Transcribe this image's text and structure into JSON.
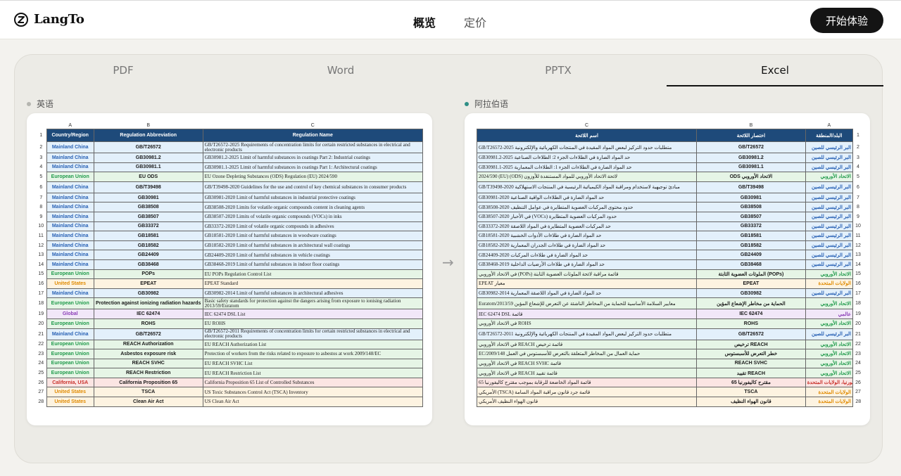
{
  "header": {
    "brand": "LangTo",
    "nav": [
      {
        "label": "概览"
      },
      {
        "label": "定价"
      }
    ],
    "cta": "开始体验"
  },
  "tabs": [
    {
      "label": "PDF"
    },
    {
      "label": "Word"
    },
    {
      "label": "PPTX"
    },
    {
      "label": "Excel"
    }
  ],
  "left_label": "英语",
  "right_label": "阿拉伯语",
  "colors": {
    "accent": "#2f8f86",
    "header_fill": "#1e4a7a",
    "china": "#2962b5",
    "eu": "#1f9a4a",
    "us": "#e08a00",
    "global": "#8c3fb8",
    "california": "#c8302a"
  },
  "left_sheet": {
    "col_letters": [
      "A",
      "B",
      "C"
    ],
    "headers": [
      "Country/Region",
      "Regulation Abbreviation",
      "Regulation Name"
    ],
    "rows": [
      {
        "n": "2",
        "region": "Mainland China",
        "abbr": "GB/T26572",
        "name": "GB/T26572-2025 Requirements of concentration limits for certain restricted substances in electrical and electronic products",
        "t": "china",
        "fill": "#e3f0fb"
      },
      {
        "n": "3",
        "region": "Mainland China",
        "abbr": "GB30981.2",
        "name": "GB30981.2-2025 Limit of harmful substances in coatings Part 2: Industrial coatings",
        "t": "china",
        "fill": "#e3f0fb"
      },
      {
        "n": "4",
        "region": "Mainland China",
        "abbr": "GB30981.1",
        "name": "GB30981.1-2025 Limit of harmful substances in coatings Part 1: Architectural coatings",
        "t": "china",
        "fill": "#e3f0fb"
      },
      {
        "n": "5",
        "region": "European Union",
        "abbr": "EU ODS",
        "name": "EU Ozone Depleting Substances (ODS) Regulation (EU) 2024/590",
        "t": "eu",
        "fill": "#e6f5e6"
      },
      {
        "n": "6",
        "region": "Mainland China",
        "abbr": "GB/T39498",
        "name": "GB/T39498-2020 Guidelines for the use and control of key chemical substances in consumer products",
        "t": "china",
        "fill": "#e3f0fb"
      },
      {
        "n": "7",
        "region": "Mainland China",
        "abbr": "GB30981",
        "name": "GB30981-2020 Limit of harmful substances in industrial protective coatings",
        "t": "china",
        "fill": "#e3f0fb"
      },
      {
        "n": "8",
        "region": "Mainland China",
        "abbr": "GB38508",
        "name": "GB38508-2020 Limits for volatile organic compounds content in cleaning agents",
        "t": "china",
        "fill": "#e3f0fb"
      },
      {
        "n": "9",
        "region": "Mainland China",
        "abbr": "GB38507",
        "name": "GB38507-2020 Limits of volatile organic compounds (VOCs) in inks",
        "t": "china",
        "fill": "#e3f0fb"
      },
      {
        "n": "10",
        "region": "Mainland China",
        "abbr": "GB33372",
        "name": "GB33372-2020 Limit of volatile organic compounds in adhesives",
        "t": "china",
        "fill": "#e3f0fb"
      },
      {
        "n": "11",
        "region": "Mainland China",
        "abbr": "GB18581",
        "name": "GB18581-2020 Limit of harmful substances in woodware coatings",
        "t": "china",
        "fill": "#e3f0fb"
      },
      {
        "n": "12",
        "region": "Mainland China",
        "abbr": "GB18582",
        "name": "GB18582-2020 Limit of harmful substances in architectural wall coatings",
        "t": "china",
        "fill": "#e3f0fb"
      },
      {
        "n": "13",
        "region": "Mainland China",
        "abbr": "GB24409",
        "name": "GB24409-2020 Limit of harmful substances in vehicle coatings",
        "t": "china",
        "fill": "#e3f0fb"
      },
      {
        "n": "14",
        "region": "Mainland China",
        "abbr": "GB38468",
        "name": "GB38468-2019 Limit of harmful substances in indoor floor coatings",
        "t": "china",
        "fill": "#e3f0fb"
      },
      {
        "n": "15",
        "region": "European Union",
        "abbr": "POPs",
        "name": "EU POPs Regulation Control List",
        "t": "eu",
        "fill": "#e6f5e6"
      },
      {
        "n": "16",
        "region": "United States",
        "abbr": "EPEAT",
        "name": "EPEAT Standard",
        "t": "us",
        "fill": "#fdf3e1"
      },
      {
        "n": "17",
        "region": "Mainland China",
        "abbr": "GB30982",
        "name": "GB30982-2014 Limit of harmful substances in architectural adhesives",
        "t": "china",
        "fill": "#e3f0fb"
      },
      {
        "n": "18",
        "region": "European Union",
        "abbr": "Protection against ionizing radiation hazards",
        "name": "Basic safety standards for protection against the dangers arising from exposure to ionising radiation 2013/59/Euratom",
        "t": "eu",
        "fill": "#e6f5e6"
      },
      {
        "n": "19",
        "region": "Global",
        "abbr": "IEC 62474",
        "name": "IEC 62474 DSL List",
        "t": "global",
        "fill": "#f1e7f8"
      },
      {
        "n": "20",
        "region": "European Union",
        "abbr": "ROHS",
        "name": "EU ROHS",
        "t": "eu",
        "fill": "#e6f5e6"
      },
      {
        "n": "21",
        "region": "Mainland China",
        "abbr": "GB/T26572",
        "name": "GB/T26572-2011 Requirements of concentration limits for certain restricted substances in electrical and electronic products",
        "t": "china",
        "fill": "#e3f0fb"
      },
      {
        "n": "22",
        "region": "European Union",
        "abbr": "REACH Authorization",
        "name": "EU REACH Authorization List",
        "t": "eu",
        "fill": "#e6f5e6"
      },
      {
        "n": "23",
        "region": "European Union",
        "abbr": "Asbestos exposure risk",
        "name": "Protection of workers from the risks related to exposure to asbestos at work 2009/148/EC",
        "t": "eu",
        "fill": "#e6f5e6"
      },
      {
        "n": "24",
        "region": "European Union",
        "abbr": "REACH SVHC",
        "name": "EU REACH SVHC List",
        "t": "eu",
        "fill": "#e6f5e6"
      },
      {
        "n": "25",
        "region": "European Union",
        "abbr": "REACH Restriction",
        "name": "EU REACH Restriction List",
        "t": "eu",
        "fill": "#e6f5e6"
      },
      {
        "n": "26",
        "region": "California, USA",
        "abbr": "California Proposition 65",
        "name": "California Proposition 65 List of Controlled Substances",
        "t": "california",
        "fill": "#fbe5e3"
      },
      {
        "n": "27",
        "region": "United States",
        "abbr": "TSCA",
        "name": "US Toxic Substances Control Act (TSCA) Inventory",
        "t": "us",
        "fill": "#fdf3e1"
      },
      {
        "n": "28",
        "region": "United States",
        "abbr": "Clean Air Act",
        "name": "US Clean Air Act",
        "t": "us",
        "fill": "#fdf3e1"
      }
    ]
  },
  "right_sheet": {
    "col_letters": [
      "C",
      "B",
      "A"
    ],
    "headers": [
      "اسم اللائحة",
      "اختصار اللائحة",
      "البلد/المنطقة"
    ],
    "rows": [
      {
        "n": "2",
        "name": "متطلبات حدود التركيز لبعض المواد المقيدة في المنتجات الكهربائية والإلكترونية GB/T26572-2025",
        "abbr": "GB/T26572",
        "region": "البر الرئيسي للصين",
        "t": "china",
        "fill": "#e3f0fb"
      },
      {
        "n": "3",
        "name": "حد المواد الضارة في الطلاءات الجزء 2: الطلاءات الصناعية GB30981.2-2025",
        "abbr": "GB30981.2",
        "region": "البر الرئيسي للصين",
        "t": "china",
        "fill": "#e3f0fb"
      },
      {
        "n": "4",
        "name": "حد المواد الضارة في الطلاءات الجزء 1: الطلاءات المعمارية GB30981.1-2025",
        "abbr": "GB30981.1",
        "region": "البر الرئيسي للصين",
        "t": "china",
        "fill": "#e3f0fb"
      },
      {
        "n": "5",
        "name": "لائحة الاتحاد الأوروبي للمواد المستنفدة للأوزون (ODS) (EU) 2024/590",
        "abbr": "ODS الاتحاد الأوروبي",
        "region": "الاتحاد الأوروبي",
        "t": "eu",
        "fill": "#e6f5e6"
      },
      {
        "n": "6",
        "name": "مبادئ توجيهية لاستخدام ومراقبة المواد الكيميائية الرئيسية في المنتجات الاستهلاكية GB/T39498-2020",
        "abbr": "GB/T39498",
        "region": "البر الرئيسي للصين",
        "t": "china",
        "fill": "#e3f0fb"
      },
      {
        "n": "7",
        "name": "حد المواد الضارة في الطلاءات الواقية الصناعية GB30981-2020",
        "abbr": "GB30981",
        "region": "البر الرئيسي للصين",
        "t": "china",
        "fill": "#e3f0fb"
      },
      {
        "n": "8",
        "name": "حدود محتوى المركبات العضوية المتطايرة في عوامل التنظيف GB38508-2020",
        "abbr": "GB38508",
        "region": "البر الرئيسي للصين",
        "t": "china",
        "fill": "#e3f0fb"
      },
      {
        "n": "9",
        "name": "حدود المركبات العضوية المتطايرة (VOCs) في الأحبار GB38507-2020",
        "abbr": "GB38507",
        "region": "البر الرئيسي للصين",
        "t": "china",
        "fill": "#e3f0fb"
      },
      {
        "n": "10",
        "name": "حد المركبات العضوية المتطايرة في المواد اللاصقة GB33372-2020",
        "abbr": "GB33372",
        "region": "البر الرئيسي للصين",
        "t": "china",
        "fill": "#e3f0fb"
      },
      {
        "n": "11",
        "name": "حد المواد الضارة في طلاءات الأدوات الخشبية GB18581-2020",
        "abbr": "GB18581",
        "region": "البر الرئيسي للصين",
        "t": "china",
        "fill": "#e3f0fb"
      },
      {
        "n": "12",
        "name": "حد المواد الضارة في طلاءات الجدران المعمارية GB18582-2020",
        "abbr": "GB18582",
        "region": "البر الرئيسي للصين",
        "t": "china",
        "fill": "#e3f0fb"
      },
      {
        "n": "13",
        "name": "حد المواد الضارة في طلاءات المركبات GB24409-2020",
        "abbr": "GB24409",
        "region": "البر الرئيسي للصين",
        "t": "china",
        "fill": "#e3f0fb"
      },
      {
        "n": "14",
        "name": "حد المواد الضارة في طلاءات الأرضيات الداخلية GB38468-2019",
        "abbr": "GB38468",
        "region": "البر الرئيسي للصين",
        "t": "china",
        "fill": "#e3f0fb"
      },
      {
        "n": "15",
        "name": "قائمة مراقبة لائحة الملوثات العضوية الثابتة (POPs) في الاتحاد الأوروبي",
        "abbr": "الملوثات العضوية الثابتة (POPs)",
        "region": "الاتحاد الأوروبي",
        "t": "eu",
        "fill": "#e6f5e6"
      },
      {
        "n": "16",
        "name": "معيار EPEAT",
        "abbr": "EPEAT",
        "region": "الولايات المتحدة",
        "t": "us",
        "fill": "#fdf3e1"
      },
      {
        "n": "17",
        "name": "حد المواد الضارة في المواد اللاصقة المعمارية GB30982-2014",
        "abbr": "GB30982",
        "region": "البر الرئيسي للصين",
        "t": "china",
        "fill": "#e3f0fb"
      },
      {
        "n": "18",
        "name": "معايير السلامة الأساسية للحماية من المخاطر الناشئة عن التعرض للإشعاع المؤين 2013/59/Euratom",
        "abbr": "الحماية من مخاطر الإشعاع المؤين",
        "region": "الاتحاد الأوروبي",
        "t": "eu",
        "fill": "#e6f5e6"
      },
      {
        "n": "19",
        "name": "قائمة IEC 62474 DSL",
        "abbr": "IEC 62474",
        "region": "عالمي",
        "t": "global",
        "fill": "#f1e7f8"
      },
      {
        "n": "20",
        "name": "ROHS في الاتحاد الأوروبي",
        "abbr": "ROHS",
        "region": "الاتحاد الأوروبي",
        "t": "eu",
        "fill": "#e6f5e6"
      },
      {
        "n": "21",
        "name": "متطلبات حدود التركيز لبعض المواد المقيدة في المنتجات الكهربائية والإلكترونية GB/T26572-2011",
        "abbr": "GB/T26572",
        "region": "البر الرئيسي للصين",
        "t": "china",
        "fill": "#e3f0fb"
      },
      {
        "n": "22",
        "name": "قائمة ترخيص REACH في الاتحاد الأوروبي",
        "abbr": "ترخيص REACH",
        "region": "الاتحاد الأوروبي",
        "t": "eu",
        "fill": "#e6f5e6"
      },
      {
        "n": "23",
        "name": "حماية العمال من المخاطر المتعلقة بالتعرض للأسبستوس في العمل 2009/148/EC",
        "abbr": "خطر التعرض للأسبستوس",
        "region": "الاتحاد الأوروبي",
        "t": "eu",
        "fill": "#e6f5e6"
      },
      {
        "n": "24",
        "name": "قائمة REACH SVHC في الاتحاد الأوروبي",
        "abbr": "REACH SVHC",
        "region": "الاتحاد الأوروبي",
        "t": "eu",
        "fill": "#e6f5e6"
      },
      {
        "n": "25",
        "name": "قائمة تقييد REACH في الاتحاد الأوروبي",
        "abbr": "تقييد REACH",
        "region": "الاتحاد الأوروبي",
        "t": "eu",
        "fill": "#e6f5e6"
      },
      {
        "n": "26",
        "name": "قائمة المواد الخاضعة للرقابة بموجب مقترح كاليفورنيا 65",
        "abbr": "مقترح كاليفورنيا 65",
        "region": "كاليفورنيا، الولايات المتحدة",
        "t": "california",
        "fill": "#fbe5e3"
      },
      {
        "n": "27",
        "name": "قائمة جرد قانون مراقبة المواد السامة (TSCA) الأمريكي",
        "abbr": "TSCA",
        "region": "الولايات المتحدة",
        "t": "us",
        "fill": "#fdf3e1"
      },
      {
        "n": "28",
        "name": "قانون الهواء النظيف الأمريكي",
        "abbr": "قانون الهواء النظيف",
        "region": "الولايات المتحدة",
        "t": "us",
        "fill": "#fdf3e1"
      }
    ]
  }
}
